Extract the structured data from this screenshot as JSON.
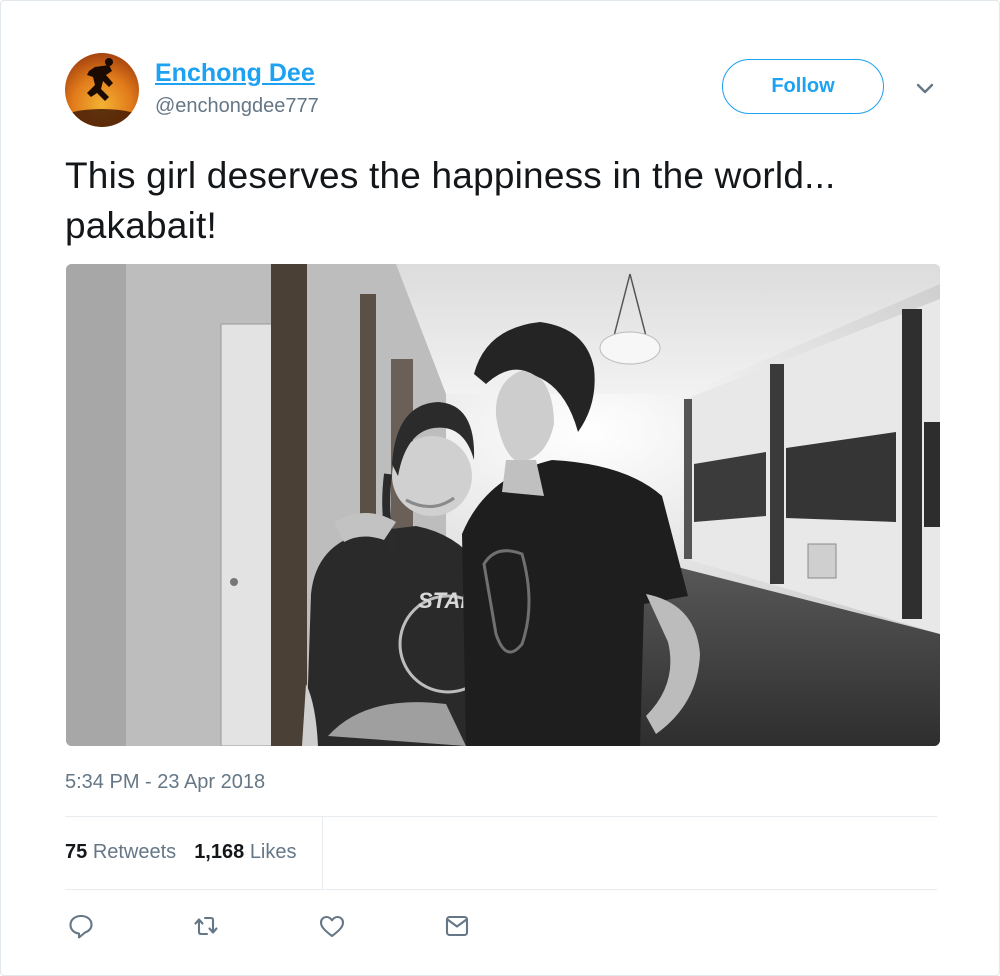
{
  "author": {
    "name": "Enchong Dee",
    "handle": "@enchongdee777"
  },
  "follow_label": "Follow",
  "tweet": {
    "text": "This girl deserves the happiness in the world... pakabait!",
    "photo_shirt_text": "STAR WARS",
    "timestamp": "5:34 PM - 23 Apr 2018"
  },
  "stats": {
    "retweets_count": "75",
    "retweets_label": "Retweets",
    "likes_count": "1,168",
    "likes_label": "Likes"
  },
  "icons": {
    "caret": "chevron-down-icon",
    "reply": "reply-icon",
    "retweet": "retweet-icon",
    "like": "heart-icon",
    "message": "envelope-icon"
  },
  "colors": {
    "accent": "#1da1f2",
    "secondary_text": "#657786",
    "icon": "#657786",
    "border": "#e1e8ed"
  }
}
